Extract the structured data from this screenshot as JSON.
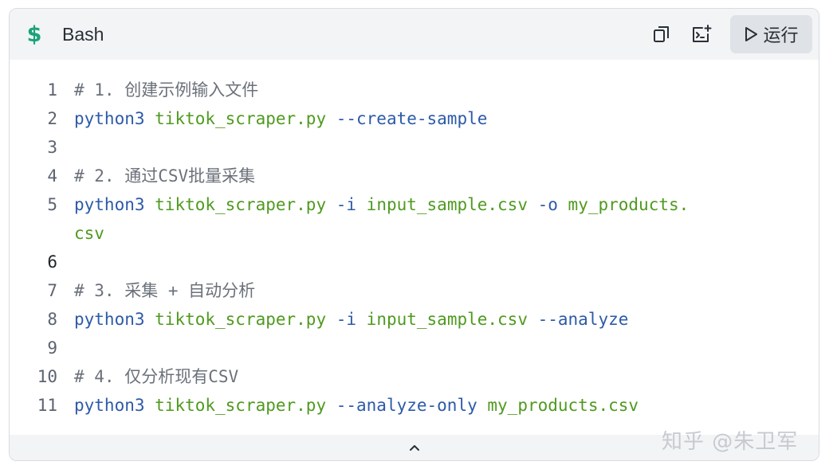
{
  "header": {
    "language_label": "Bash",
    "run_label": "运行",
    "icons": [
      "dollar-icon",
      "copy-icon",
      "insert-icon",
      "play-icon"
    ]
  },
  "code": {
    "lines": [
      {
        "num": "1",
        "tokens": [
          {
            "t": "# 1. 创建示例输入文件",
            "c": "comment"
          }
        ]
      },
      {
        "num": "2",
        "tokens": [
          {
            "t": "python3 ",
            "c": "kw"
          },
          {
            "t": "tiktok_scraper.py ",
            "c": "str"
          },
          {
            "t": "--create-sample",
            "c": "kw"
          }
        ]
      },
      {
        "num": "3",
        "tokens": []
      },
      {
        "num": "4",
        "tokens": [
          {
            "t": "# 2. 通过CSV批量采集",
            "c": "comment"
          }
        ]
      },
      {
        "num": "5",
        "tokens": [
          {
            "t": "python3 ",
            "c": "kw"
          },
          {
            "t": "tiktok_scraper.py ",
            "c": "str"
          },
          {
            "t": "-i ",
            "c": "kw"
          },
          {
            "t": "input_sample.csv ",
            "c": "str"
          },
          {
            "t": "-o ",
            "c": "kw"
          },
          {
            "t": "my_products.",
            "c": "str"
          }
        ]
      },
      {
        "num": "",
        "tokens": [
          {
            "t": "csv",
            "c": "str"
          }
        ]
      },
      {
        "num": "6",
        "tokens": []
      },
      {
        "num": "7",
        "tokens": [
          {
            "t": "# 3. 采集 + 自动分析",
            "c": "comment"
          }
        ]
      },
      {
        "num": "8",
        "tokens": [
          {
            "t": "python3 ",
            "c": "kw"
          },
          {
            "t": "tiktok_scraper.py ",
            "c": "str"
          },
          {
            "t": "-i ",
            "c": "kw"
          },
          {
            "t": "input_sample.csv ",
            "c": "str"
          },
          {
            "t": "--analyze",
            "c": "kw"
          }
        ]
      },
      {
        "num": "9",
        "tokens": []
      },
      {
        "num": "10",
        "tokens": [
          {
            "t": "# 4. 仅分析现有CSV",
            "c": "comment"
          }
        ]
      },
      {
        "num": "11",
        "tokens": [
          {
            "t": "python3 ",
            "c": "kw"
          },
          {
            "t": "tiktok_scraper.py ",
            "c": "str"
          },
          {
            "t": "--analyze-only ",
            "c": "kw"
          },
          {
            "t": "my_products.csv",
            "c": "str"
          }
        ]
      }
    ],
    "active_line": "6"
  },
  "footer": {
    "collapse_icon": "chevron-up-icon"
  },
  "watermark": "知乎 @朱卫军",
  "colors": {
    "comment": "#6b717a",
    "keyword": "#2d5aa8",
    "string": "#4f9a1f",
    "dollar": "#1aa37a",
    "header_bg": "#f3f4f6"
  }
}
